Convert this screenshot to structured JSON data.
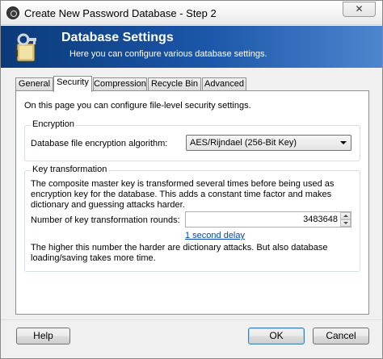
{
  "window": {
    "title": "Create New Password Database - Step 2",
    "close_label": "✕"
  },
  "banner": {
    "title": "Database Settings",
    "subtitle": "Here you can configure various database settings.",
    "background_color": "#1c57a9"
  },
  "tabs": [
    {
      "label": "General",
      "active": false
    },
    {
      "label": "Security",
      "active": true
    },
    {
      "label": "Compression",
      "active": false
    },
    {
      "label": "Recycle Bin",
      "active": false
    },
    {
      "label": "Advanced",
      "active": false
    }
  ],
  "security": {
    "intro": "On this page you can configure file-level security settings.",
    "encryption": {
      "group_label": "Encryption",
      "algorithm_label": "Database file encryption algorithm:",
      "algorithm_value": "AES/Rijndael (256-Bit Key)"
    },
    "key_transformation": {
      "group_label": "Key transformation",
      "description": "The composite master key is transformed several times before being used as encryption key for the database. This adds a constant time factor and makes dictionary and guessing attacks harder.",
      "rounds_label": "Number of key transformation rounds:",
      "rounds_value": "3483648",
      "delay_link": "1 second delay",
      "note": "The higher this number the harder are dictionary attacks. But also database loading/saving takes more time."
    }
  },
  "buttons": {
    "help": "Help",
    "ok": "OK",
    "cancel": "Cancel"
  }
}
